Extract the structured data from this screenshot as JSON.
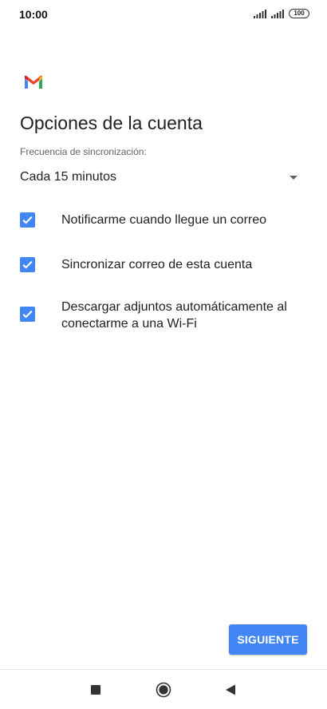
{
  "status_bar": {
    "time": "10:00",
    "battery_level": "100"
  },
  "app": {
    "logo_icon": "gmail-logo-icon",
    "colors": {
      "red": "#ea4335",
      "blue": "#4285f4",
      "green": "#34a853",
      "yellow": "#fbbc04"
    }
  },
  "page": {
    "title": "Opciones de la cuenta"
  },
  "sync": {
    "label": "Frecuencia de sincronización:",
    "selected": "Cada 15 minutos"
  },
  "options": [
    {
      "label": "Notificarme cuando llegue un correo",
      "checked": true
    },
    {
      "label": "Sincronizar correo de esta cuenta",
      "checked": true
    },
    {
      "label": "Descargar adjuntos automáticamente al conectarme a una Wi-Fi",
      "checked": true
    }
  ],
  "actions": {
    "next_label": "SIGUIENTE"
  },
  "nav_bar": {
    "icons": [
      "recents-square-icon",
      "home-circle-icon",
      "back-triangle-icon"
    ]
  },
  "theme": {
    "accent": "#4285f4",
    "text": "#202124",
    "secondary_text": "#5f6368"
  }
}
